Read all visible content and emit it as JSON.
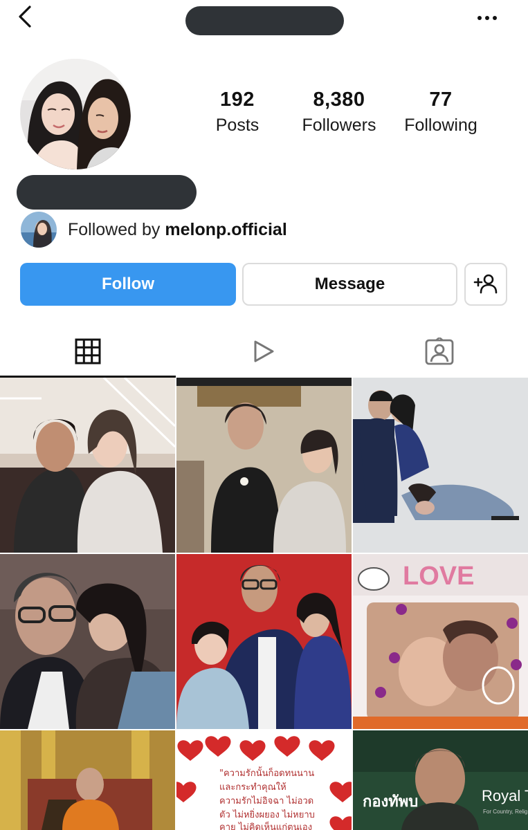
{
  "header": {
    "username_redacted": "",
    "back_icon": "chevron-left-icon",
    "more_icon": "more-horizontal-icon"
  },
  "profile": {
    "posts_count": "192",
    "posts_label": "Posts",
    "followers_count": "8,380",
    "followers_label": "Followers",
    "following_count": "77",
    "following_label": "Following",
    "name_redacted": ""
  },
  "followed_by": {
    "prefix": "Followed by ",
    "username": "melonp.official"
  },
  "actions": {
    "follow_label": "Follow",
    "message_label": "Message",
    "add_user_icon": "add-user-icon"
  },
  "tabs": [
    {
      "icon": "grid-icon",
      "active": true
    },
    {
      "icon": "reels-icon",
      "active": false
    },
    {
      "icon": "tagged-icon",
      "active": false
    }
  ],
  "posts": {
    "love_sticker": "LOVE",
    "quote_line1": "\"ความรักนั้นก็อดทนนาน",
    "quote_line2": "และกระทำคุณให้",
    "quote_line3": "ความรักไม่อิจฉา ไม่อวด",
    "quote_line4": "ตัว ไม่หยิ่งผยอง ไม่หยาบ",
    "quote_line5": "คาย ไม่คิดเห็นแก่ตนเอง",
    "army_text": "กองทัพบ",
    "royal_text": "Royal T",
    "royal_sub": "For Country, Relig"
  },
  "colors": {
    "accent": "#3897f0",
    "redaction": "#2f3337",
    "border": "#dbdbdb"
  }
}
